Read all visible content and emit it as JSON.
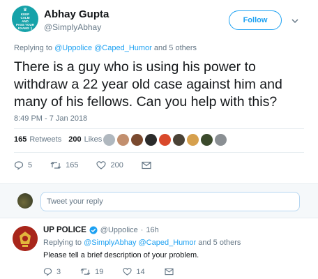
{
  "tweet": {
    "author_name": "Abhay Gupta",
    "author_handle": "@SimplyAbhay",
    "avatar_lines": [
      "KEEP",
      "CALM",
      "AND",
      "PASS YOUR",
      "EXAMS :)"
    ],
    "follow_label": "Follow",
    "replying_prefix": "Replying to ",
    "replying_to": "@Uppolice @Caped_Humor",
    "replying_suffix": " and 5 others",
    "text": "There is a guy who is using his power to withdraw a 22 year old case against him and many of his fellows. Can you help with this?",
    "timestamp": "8:49 PM - 7 Jan 2018",
    "retweets_count": "165",
    "retweets_label": "Retweets",
    "likes_count": "200",
    "likes_label": "Likes",
    "liker_colors": [
      "#b0b8bf",
      "#c28f6e",
      "#7a4a2f",
      "#2b2b2b",
      "#d9492b",
      "#4a4236",
      "#d6a04d",
      "#3b4a2c",
      "#8a8f93"
    ],
    "actions": {
      "reply_count": "5",
      "retweet_count": "165",
      "like_count": "200"
    }
  },
  "reply_box": {
    "placeholder": "Tweet your reply"
  },
  "reply": {
    "author_name": "UP POLICE",
    "verified": true,
    "author_handle": "@Uppolice",
    "time": "16h",
    "replying_prefix": "Replying to ",
    "replying_to": "@SimplyAbhay @Caped_Humor",
    "replying_suffix": " and 5 others",
    "text": "Please tell a brief description of your problem.",
    "actions": {
      "reply_count": "3",
      "retweet_count": "19",
      "like_count": "14"
    }
  },
  "colors": {
    "accent": "#1da1f2",
    "muted": "#657786",
    "text": "#14171a",
    "divider": "#e6ecf0"
  }
}
